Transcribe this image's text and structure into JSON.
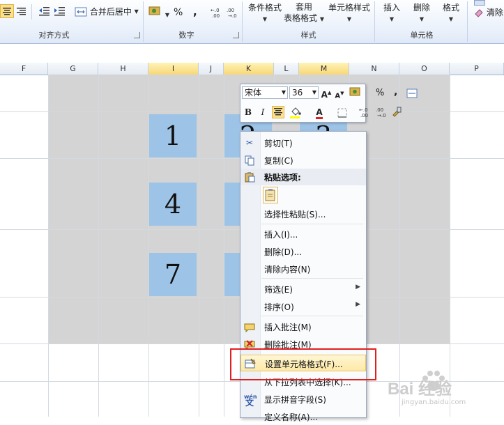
{
  "ribbon": {
    "merge_center_label": "合并后居中",
    "percent_symbol": "%",
    "comma_symbol": ",",
    "conditional_format_label": "条件格式",
    "table_format_line1": "套用",
    "table_format_line2": "表格格式",
    "cell_styles_label": "单元格样式",
    "insert_label": "插入",
    "delete_label": "删除",
    "format_label": "格式",
    "clear_label": "清除",
    "groups": {
      "alignment": "对齐方式",
      "number": "数字",
      "styles": "样式",
      "cells": "单元格"
    }
  },
  "columns": [
    "F",
    "G",
    "H",
    "I",
    "J",
    "K",
    "L",
    "M",
    "N",
    "O",
    "P"
  ],
  "selected_columns": [
    "I",
    "K",
    "M"
  ],
  "cells": {
    "c1": "1",
    "c2": "2",
    "c3": "3",
    "c4": "4",
    "c7": "7"
  },
  "mini_toolbar": {
    "font_name": "宋体",
    "font_size": "36",
    "percent": "%",
    "comma": ",",
    "bold": "B",
    "italic": "I",
    "font_color_letter": "A"
  },
  "context_menu": {
    "cut": "剪切(T)",
    "copy": "复制(C)",
    "paste_options": "粘贴选项:",
    "paste_special": "选择性粘贴(S)...",
    "insert": "插入(I)...",
    "delete": "删除(D)...",
    "clear_contents": "清除内容(N)",
    "filter": "筛选(E)",
    "sort": "排序(O)",
    "insert_comment": "插入批注(M)",
    "delete_comment": "删除批注(M)",
    "format_cells": "设置单元格格式(F)...",
    "pick_from_list": "从下拉列表中选择(K)...",
    "phonetic": "显示拼音字段(S)",
    "define_name": "定义名称(A)..."
  },
  "watermark": {
    "brand": "Bai 经验",
    "url": "jingyan.baidu.com"
  },
  "colors": {
    "selected_cell": "#9dc3e6",
    "highlight_border": "#e02020",
    "menu_highlight": "#fde9a6"
  }
}
